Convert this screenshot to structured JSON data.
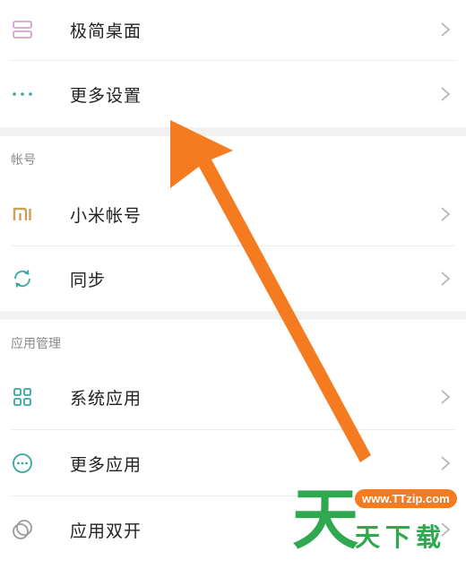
{
  "colors": {
    "accent": "#f47b20",
    "icon_teal": "#3aa6a0",
    "mi_gold": "#c9a15a",
    "watermark_green": "#2fa84f"
  },
  "groups": {
    "top": {
      "items": [
        {
          "label": "极简桌面",
          "icon": "layout-icon"
        },
        {
          "label": "更多设置",
          "icon": "more-dots-icon"
        }
      ]
    },
    "account": {
      "header": "帐号",
      "items": [
        {
          "label": "小米帐号",
          "icon": "mi-logo-icon"
        },
        {
          "label": "同步",
          "icon": "sync-icon"
        }
      ]
    },
    "apps": {
      "header": "应用管理",
      "items": [
        {
          "label": "系统应用",
          "icon": "grid-icon"
        },
        {
          "label": "更多应用",
          "icon": "more-circle-icon"
        },
        {
          "label": "应用双开",
          "icon": "dual-circle-icon"
        }
      ]
    }
  },
  "watermark": {
    "url": "www.TTzip.com",
    "big_char": "天",
    "text": "天下载"
  }
}
